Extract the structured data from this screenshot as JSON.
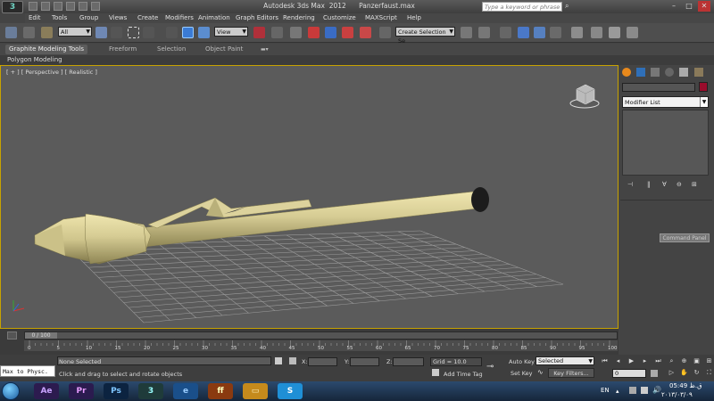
{
  "window": {
    "title": "Autodesk 3ds Max  2012      Panzerfaust.max",
    "search_placeholder": "Type a keyword or phrase"
  },
  "menu": [
    "Edit",
    "Tools",
    "Group",
    "Views",
    "Create",
    "Modifiers",
    "Animation",
    "Graph Editors",
    "Rendering",
    "Customize",
    "MAXScript",
    "Help"
  ],
  "toolbar": {
    "selection_filter": "All",
    "reference_coord": "View",
    "named_selection": "Create Selection Se"
  },
  "ribbon": {
    "tabs": [
      "Graphite Modeling Tools",
      "Freeform",
      "Selection",
      "Object Paint"
    ],
    "active_panel": "Polygon Modeling"
  },
  "viewport": {
    "label": "[ + ] [ Perspective ] [ Realistic ]",
    "viewcube_label": "FRONT",
    "colors": {
      "background": "#5b5b5b",
      "grid": "#9a9a9a",
      "model": "#d6cc94",
      "active_border": "#c7a200"
    }
  },
  "command_panel": {
    "modifier_list": "Modifier List",
    "tooltip": "Command Panel"
  },
  "timeline": {
    "slider_label": "0 / 100",
    "ticks": [
      "0",
      "5",
      "10",
      "15",
      "20",
      "25",
      "30",
      "35",
      "40",
      "45",
      "50",
      "55",
      "60",
      "65",
      "70",
      "75",
      "80",
      "85",
      "90",
      "95",
      "100"
    ]
  },
  "status": {
    "maxscript": "Max to Physc.",
    "selection_status": "None Selected",
    "prompt": "Click and drag to select and rotate objects",
    "x_label": "X:",
    "y_label": "Y:",
    "z_label": "Z:",
    "grid": "Grid = 10.0",
    "auto_key": "Auto Key",
    "key_mode": "Selected",
    "set_key": "Set Key",
    "key_filters": "Key Filters...",
    "add_time_tag": "Add Time Tag",
    "current_frame": "0"
  },
  "taskbar": {
    "apps": [
      {
        "name": "after-effects-icon",
        "label": "Ae",
        "color": "#2c1b4f",
        "fg": "#c9a3ff"
      },
      {
        "name": "premiere-icon",
        "label": "Pr",
        "color": "#2b1b4f",
        "fg": "#e89cff"
      },
      {
        "name": "photoshop-icon",
        "label": "Ps",
        "color": "#0c2340",
        "fg": "#7fc6ff"
      },
      {
        "name": "3dsmax-icon",
        "label": "3",
        "color": "#1f3b3a",
        "fg": "#9ff"
      },
      {
        "name": "ie-icon",
        "label": "e",
        "color": "#1a4f8a",
        "fg": "#9cf"
      },
      {
        "name": "firefox-icon",
        "label": "ff",
        "color": "#8a3a10",
        "fg": "#ffb"
      },
      {
        "name": "folder-icon",
        "label": "▭",
        "color": "#c58a1c",
        "fg": "#fff3c0"
      },
      {
        "name": "skype-icon",
        "label": "S",
        "color": "#1f8fd6",
        "fg": "#fff"
      }
    ],
    "language": "EN",
    "time": "05:49 ق.ظ",
    "date": "۲۰۱۳/۰۳/۰۹"
  }
}
